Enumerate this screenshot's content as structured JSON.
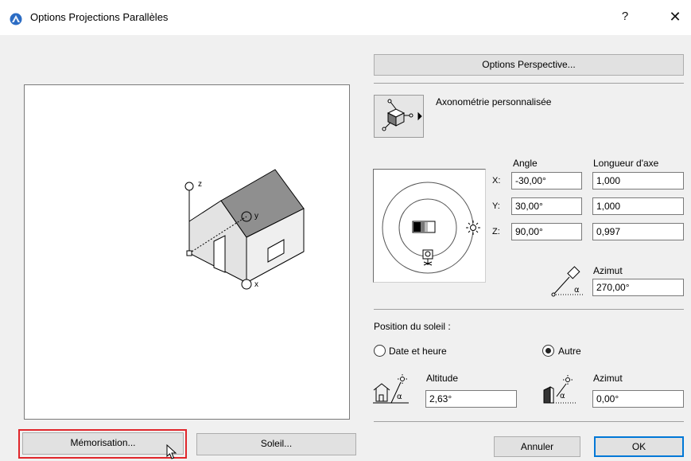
{
  "window": {
    "title": "Options Projections Parallèles",
    "help_label": "?",
    "close_label": "✕"
  },
  "buttons": {
    "perspective": "Options Perspective...",
    "memorisation": "Mémorisation...",
    "soleil": "Soleil...",
    "annuler": "Annuler",
    "ok": "OK"
  },
  "projection": {
    "mode_label": "Axonométrie personnalisée"
  },
  "preview": {
    "axis_z": "z",
    "axis_y": "y",
    "axis_x": "x"
  },
  "angles": {
    "angle_header": "Angle",
    "length_header": "Longueur d'axe",
    "rows": [
      {
        "axis": "X:",
        "angle": "-30,00°",
        "length": "1,000"
      },
      {
        "axis": "Y:",
        "angle": "30,00°",
        "length": "1,000"
      },
      {
        "axis": "Z:",
        "angle": "90,00°",
        "length": "0,997"
      }
    ],
    "azimut_label": "Azimut",
    "azimut_value": "270,00°"
  },
  "sun": {
    "section_label": "Position du soleil :",
    "option_date": "Date et heure",
    "option_other": "Autre",
    "selected": "Autre",
    "altitude_label": "Altitude",
    "altitude_value": "2,63°",
    "azimut_label": "Azimut",
    "azimut_value": "0,00°"
  },
  "colors": {
    "accent": "#0078d7",
    "highlight": "#e0262b",
    "app_icon": "#2b6cc4"
  }
}
